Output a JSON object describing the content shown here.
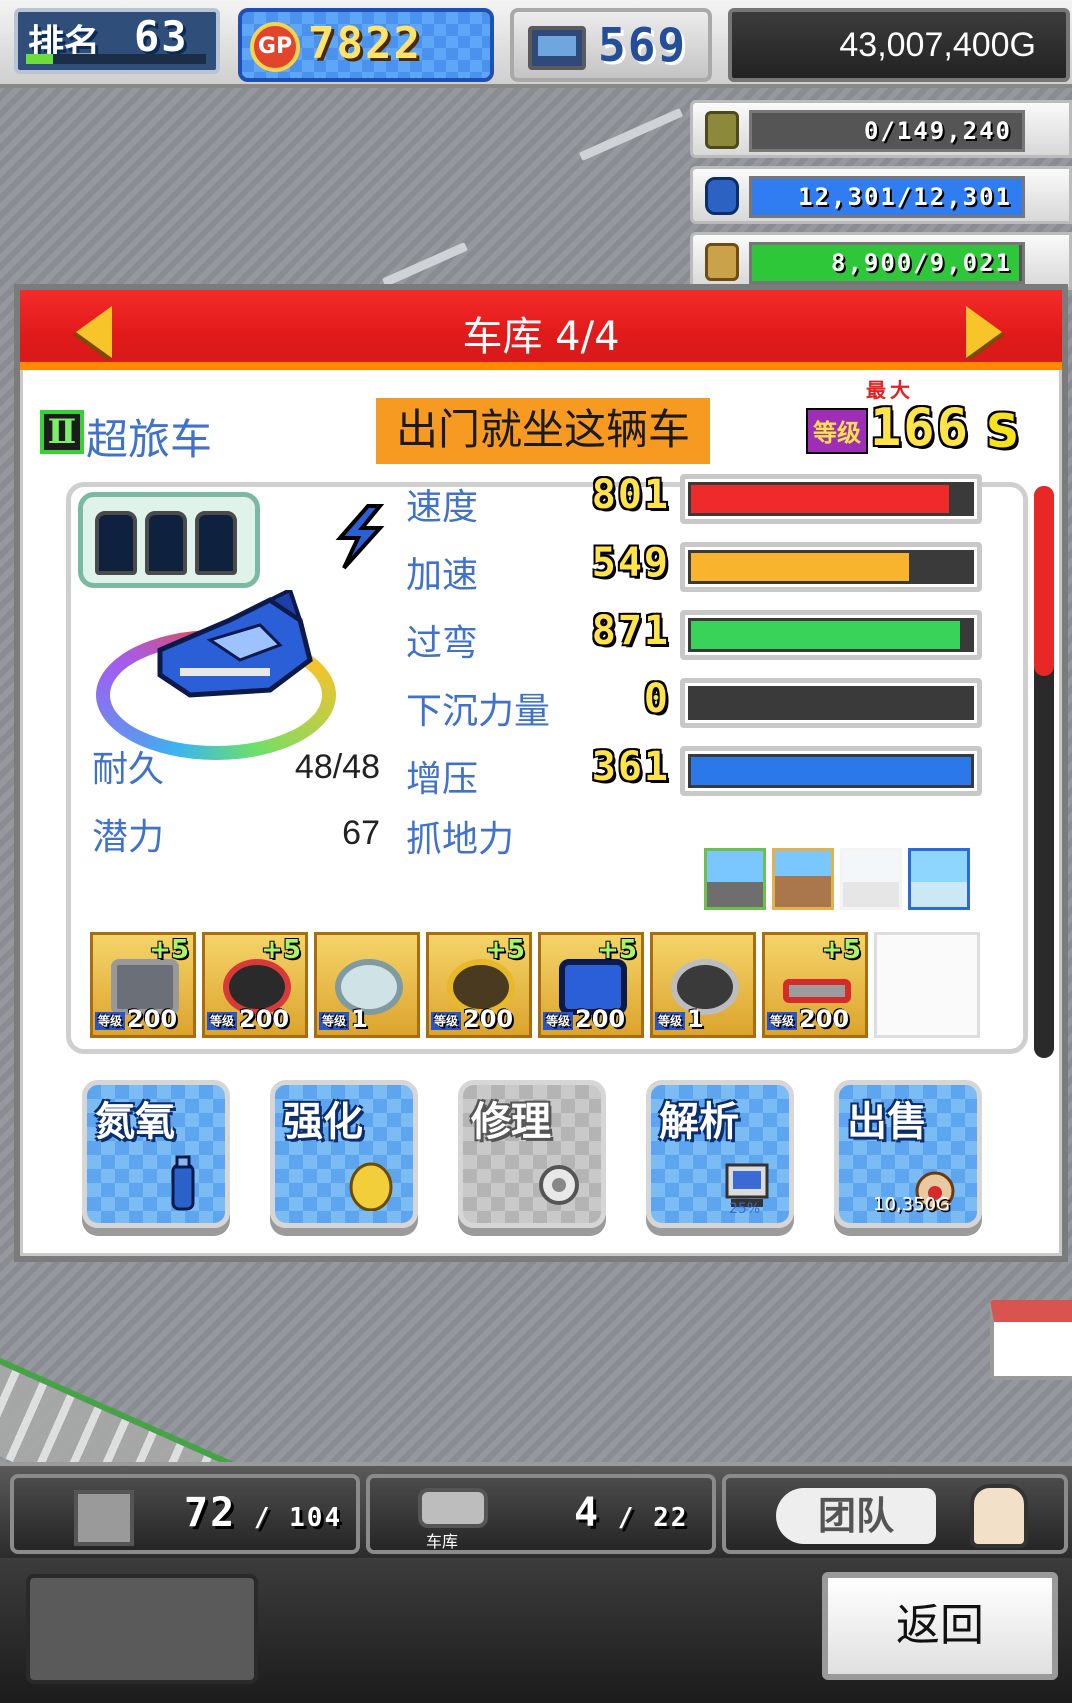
{
  "header": {
    "rank_label": "排名",
    "rank_value": "63",
    "rank_progress": 0.15,
    "gp_icon_text": "GP",
    "gp_value": "7822",
    "research_value": "569",
    "money": "43,007,400G"
  },
  "resources": [
    {
      "icon": "coin-stack-icon",
      "value": "0/149,240",
      "fill": 0.0,
      "color": "#9e9e9e"
    },
    {
      "icon": "fuel-bottle-icon",
      "value": "12,301/12,301",
      "fill": 1.0,
      "color": "#2f7df0"
    },
    {
      "icon": "wheat-icon",
      "value": "8,900/9,021",
      "fill": 0.99,
      "color": "#2ec73a"
    }
  ],
  "panel": {
    "title": "车库 4/4",
    "class_badge": "Ⅱ",
    "car_type": "超旅车",
    "nickname": "出门就坐这辆车",
    "max_label": "最大",
    "level_label": "等级",
    "level_value": "166",
    "rank_letter": "S"
  },
  "stats": [
    {
      "label": "速度",
      "value": "801",
      "fill": 0.92,
      "color": "#ee2a2a"
    },
    {
      "label": "加速",
      "value": "549",
      "fill": 0.78,
      "color": "#f7b42c"
    },
    {
      "label": "过弯",
      "value": "871",
      "fill": 0.96,
      "color": "#39d35a"
    },
    {
      "label": "下沉力量",
      "value": "0",
      "fill": 0.0,
      "color": "#444444"
    },
    {
      "label": "增压",
      "value": "361",
      "fill": 1.0,
      "color": "#2b78ea"
    }
  ],
  "left_stats": {
    "durability_label": "耐久",
    "durability_value": "48/48",
    "potential_label": "潜力",
    "potential_value": "67",
    "grip_label": "抓地力"
  },
  "terrains": [
    "sunny-road-icon",
    "dirt-mountain-icon",
    "snow-road-icon",
    "ice-mountain-icon"
  ],
  "parts": [
    {
      "name": "engine-part",
      "plus": "+5",
      "level_tag": "等级",
      "level": "200"
    },
    {
      "name": "tire-part",
      "plus": "+5",
      "level_tag": "等级",
      "level": "200"
    },
    {
      "name": "filter-part",
      "plus": "",
      "level_tag": "等级",
      "level": "1"
    },
    {
      "name": "brake-part",
      "plus": "+5",
      "level_tag": "等级",
      "level": "200"
    },
    {
      "name": "booster-part",
      "plus": "+5",
      "level_tag": "等级",
      "level": "200"
    },
    {
      "name": "turbo-part",
      "plus": "",
      "level_tag": "等级",
      "level": "1"
    },
    {
      "name": "exhaust-part",
      "plus": "+5",
      "level_tag": "等级",
      "level": "200"
    }
  ],
  "actions": {
    "nitro": "氮氧",
    "enhance": "强化",
    "repair": "修理",
    "analyze": "解析",
    "analyze_badge": "25%",
    "sell": "出售",
    "sell_price": "10,350G"
  },
  "bottom": {
    "items_count": "72",
    "items_max": "104",
    "garage_label": "车库",
    "garage_count": "4",
    "garage_max": "22",
    "team_label": "团队",
    "back_button": "返回"
  }
}
